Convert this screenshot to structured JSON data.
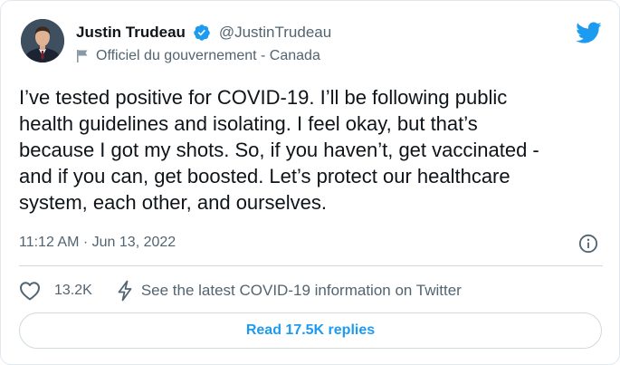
{
  "author": {
    "name": "Justin Trudeau",
    "handle": "@JustinTrudeau",
    "verified_icon": "verified-badge-icon",
    "avatar": "avatar-photo"
  },
  "account_label": {
    "icon": "flag-icon",
    "text": "Officiel du gouvernement - Canada"
  },
  "brand": {
    "icon": "twitter-bird-icon",
    "color": "#1d9bf0"
  },
  "tweet": {
    "text": "I’ve tested positive for COVID-19. I’ll be following public\nhealth guidelines and isolating. I feel okay, but that’s\nbecause I got my shots. So, if you haven’t, get vaccinated -\nand if you can, get boosted. Let’s protect our healthcare\nsystem, each other, and ourselves.",
    "time": "11:12 AM",
    "separator": "·",
    "date": "Jun 13, 2022",
    "info_icon": "info-icon"
  },
  "actions": {
    "like_icon": "heart-icon",
    "like_count": "13.2K",
    "covid_icon": "lightning-icon",
    "covid_link": "See the latest COVID-19 information on Twitter"
  },
  "replies_button": {
    "label": "Read 17.5K replies"
  },
  "colors": {
    "text": "#0f1419",
    "secondary": "#536471",
    "accent": "#1d9bf0",
    "border": "#cfd9de"
  }
}
